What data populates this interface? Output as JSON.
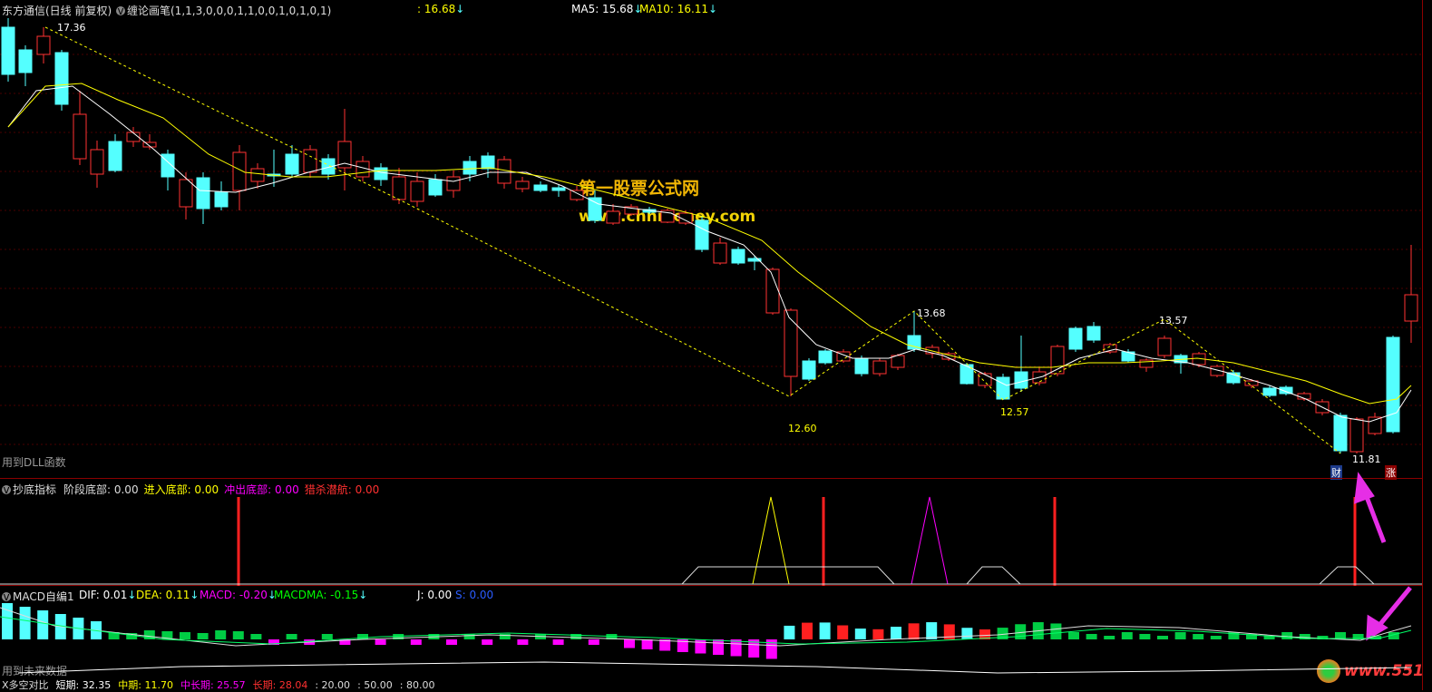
{
  "main_panel": {
    "stock": "东方通信(日线 前复权)",
    "indicator": "缠论画笔(1,1,3,0,0,0,1,1,0,0,1,0,1,0,1)",
    "price_tag": ": 16.68",
    "ma5_label": "MA5: 15.68",
    "ma10_label": "MA10: 16.11",
    "arrow": "↓",
    "dll_note": "用到DLL函数",
    "watermark_cn": "第一股票公式网",
    "watermark_url": "www.chnmoney.com",
    "peak_labels": [
      "17.36",
      "13.68",
      "13.57",
      "12.60",
      "12.57",
      "11.81"
    ],
    "cai_badge": "财",
    "zhang_badge": "涨"
  },
  "bottom_panel": {
    "name": "抄底指标",
    "fields": [
      {
        "label": "阶段底部",
        "value": "0.00",
        "color": "#dddddd"
      },
      {
        "label": "进入底部",
        "value": "0.00",
        "color": "#ffff00"
      },
      {
        "label": "冲出底部",
        "value": "0.00",
        "color": "#ff00ff"
      },
      {
        "label": "猎杀潜航",
        "value": "0.00",
        "color": "#ff3030"
      }
    ]
  },
  "macd_panel": {
    "name": "MACD自编1",
    "dif": "DIF: 0.01",
    "dea": "DEA: 0.11",
    "macd": "MACD: -0.20",
    "macdma": "MACDMA: -0.15",
    "j": "J: 0.00",
    "s": "S: 0.00",
    "future_note": "用到未来数据"
  },
  "bottom_strip": {
    "items": [
      "X多空对比",
      "短期: 32.35",
      "中期: 11.70",
      "中长期: 25.57",
      "长期: 28.04",
      ": 20.00",
      ": 50.00",
      ": 80.00"
    ]
  },
  "brand_logo_text": "www.551",
  "colors": {
    "up": "#ff3232",
    "down": "#54ffff",
    "ma5": "#ffffff",
    "ma10": "#ffff00",
    "frame": "#8b0000"
  }
}
